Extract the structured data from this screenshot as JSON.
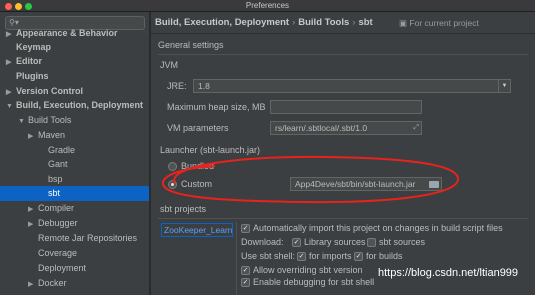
{
  "window": {
    "title": "Preferences"
  },
  "sidebar": {
    "search_icon": "search-icon",
    "items": [
      {
        "label": "Appearance & Behavior",
        "arrow": "▶",
        "bold": true
      },
      {
        "label": "Keymap",
        "arrow": "",
        "bold": true
      },
      {
        "label": "Editor",
        "arrow": "▶",
        "bold": true
      },
      {
        "label": "Plugins",
        "arrow": "",
        "bold": true
      },
      {
        "label": "Version Control",
        "arrow": "▶",
        "bold": true
      },
      {
        "label": "Build, Execution, Deployment",
        "arrow": "▼",
        "bold": true
      },
      {
        "label": "Build Tools",
        "arrow": "▼",
        "bold": false
      },
      {
        "label": "Maven",
        "arrow": "▶",
        "bold": false
      },
      {
        "label": "Gradle",
        "arrow": "",
        "bold": false
      },
      {
        "label": "Gant",
        "arrow": "",
        "bold": false
      },
      {
        "label": "bsp",
        "arrow": "",
        "bold": false
      },
      {
        "label": "sbt",
        "arrow": "",
        "bold": false
      },
      {
        "label": "Compiler",
        "arrow": "▶",
        "bold": false
      },
      {
        "label": "Debugger",
        "arrow": "▶",
        "bold": false
      },
      {
        "label": "Remote Jar Repositories",
        "arrow": "",
        "bold": false
      },
      {
        "label": "Coverage",
        "arrow": "",
        "bold": false
      },
      {
        "label": "Deployment",
        "arrow": "",
        "bold": false
      },
      {
        "label": "Docker",
        "arrow": "▶",
        "bold": false
      }
    ]
  },
  "header": {
    "crumbs": [
      "Build, Execution, Deployment",
      "Build Tools",
      "sbt"
    ],
    "separator": "›",
    "for_current_project": "For current project"
  },
  "general_settings": {
    "title": "General settings"
  },
  "jvm": {
    "title": "JVM",
    "jre_label": "JRE:",
    "jre_value": "1.8",
    "heap_label": "Maximum heap size, MB",
    "heap_value": "",
    "vm_label": "VM parameters",
    "vm_value": "rs/learn/.sbtlocal/.sbt/1.0"
  },
  "launcher": {
    "title": "Launcher (sbt-launch.jar)",
    "bundled_label": "Bundled",
    "custom_label": "Custom",
    "custom_path": "App4Deve/sbt/bin/sbt-launch.jar"
  },
  "sbt_projects": {
    "title": "sbt projects",
    "project": "ZooKeeper_Learn",
    "auto_import": "Automatically import this project on changes in build script files",
    "download_label": "Download:",
    "library_sources": "Library sources",
    "sbt_sources": "sbt sources",
    "use_sbt_shell": "Use sbt shell:",
    "for_imports": "for imports",
    "for_builds": "for builds",
    "allow_overriding": "Allow overriding sbt version",
    "enable_debugging": "Enable debugging for sbt shell"
  },
  "watermark": "https://blog.csdn.net/ltian999",
  "colors": {
    "selection": "#0d63c4",
    "annotation": "#e8231d"
  }
}
